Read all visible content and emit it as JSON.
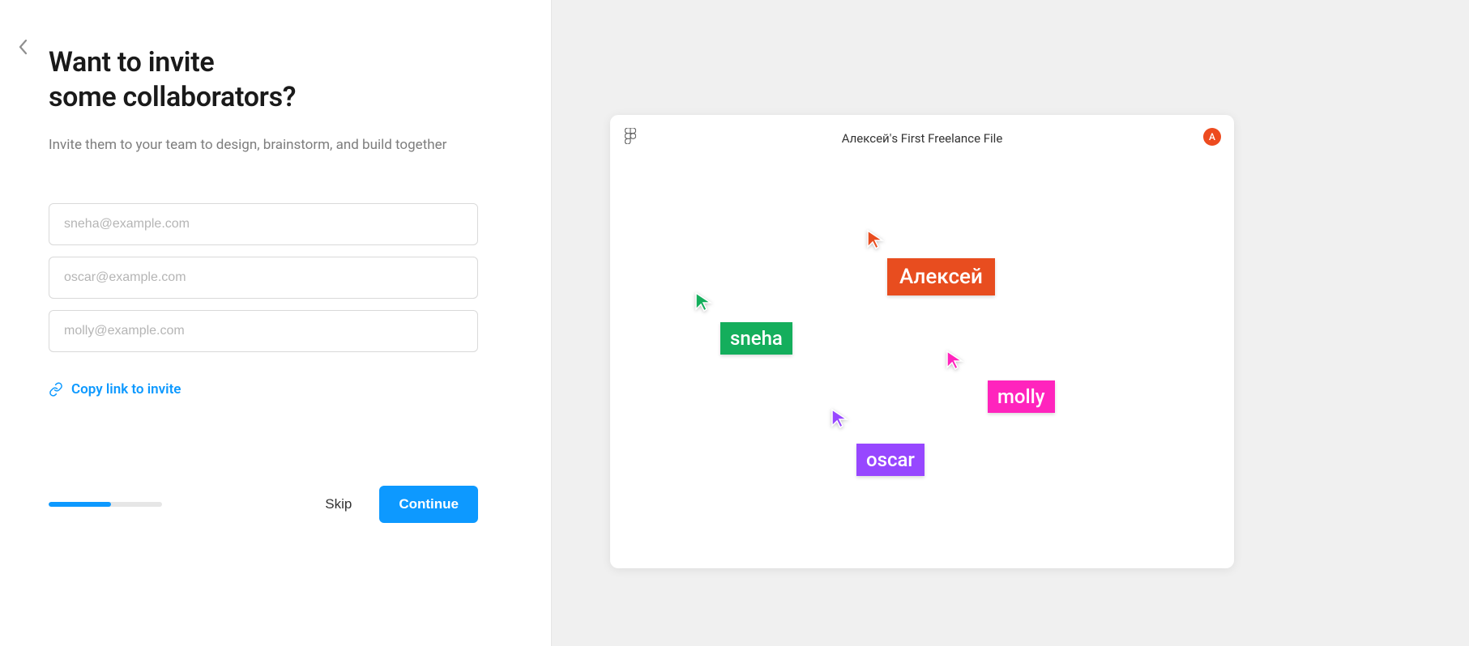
{
  "title_line1": "Want to invite",
  "title_line2": "some collaborators?",
  "subtitle": "Invite them to your team to design, brainstorm, and build together",
  "inputs": {
    "placeholder1": "sneha@example.com",
    "placeholder2": "oscar@example.com",
    "placeholder3": "molly@example.com"
  },
  "copy_link_label": "Copy link to invite",
  "footer": {
    "skip_label": "Skip",
    "continue_label": "Continue",
    "progress_percent": 55
  },
  "canvas": {
    "title": "Алексей's First Freelance File",
    "avatar_letter": "А",
    "cursors": {
      "main": {
        "name": "Алексей",
        "color": "#e84d1f"
      },
      "sneha": {
        "name": "sneha",
        "color": "#14ae5c"
      },
      "molly": {
        "name": "molly",
        "color": "#ff24bd"
      },
      "oscar": {
        "name": "oscar",
        "color": "#9747ff"
      }
    }
  },
  "colors": {
    "accent": "#0d99ff"
  }
}
